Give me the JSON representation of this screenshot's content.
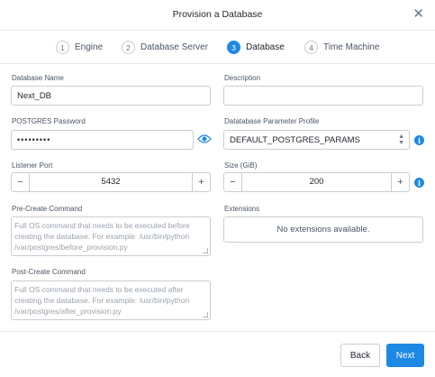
{
  "dialog": {
    "title": "Provision a Database"
  },
  "steps": [
    {
      "number": "1",
      "label": "Engine"
    },
    {
      "number": "2",
      "label": "Database Server"
    },
    {
      "number": "3",
      "label": "Database"
    },
    {
      "number": "4",
      "label": "Time Machine"
    }
  ],
  "form": {
    "database_name": {
      "label": "Database Name",
      "value": "Next_DB"
    },
    "description": {
      "label": "Description",
      "value": ""
    },
    "postgres_password": {
      "label": "POSTGRES Password",
      "value": "•••••••••"
    },
    "parameter_profile": {
      "label": "Datatabase Parameter Profile",
      "value": "DEFAULT_POSTGRES_PARAMS"
    },
    "listener_port": {
      "label": "Listener Port",
      "value": "5432"
    },
    "size": {
      "label": "Size (GiB)",
      "value": "200"
    },
    "pre_create": {
      "label": "Pre-Create Command",
      "placeholder": "Full OS command that needs to be executed before creating the database. For example: /usr/bin/python /var/postgres/before_provision.py"
    },
    "post_create": {
      "label": "Post-Create Command",
      "placeholder": "Full OS command that needs to be executed after creating the database. For example: /usr/bin/python /var/postgres/after_provision.py"
    },
    "extensions": {
      "label": "Extensions",
      "empty_text": "No extensions available."
    }
  },
  "stepper_symbols": {
    "minus": "−",
    "plus": "+"
  },
  "footer": {
    "back_label": "Back",
    "next_label": "Next"
  },
  "colors": {
    "accent": "#1e88e5"
  }
}
